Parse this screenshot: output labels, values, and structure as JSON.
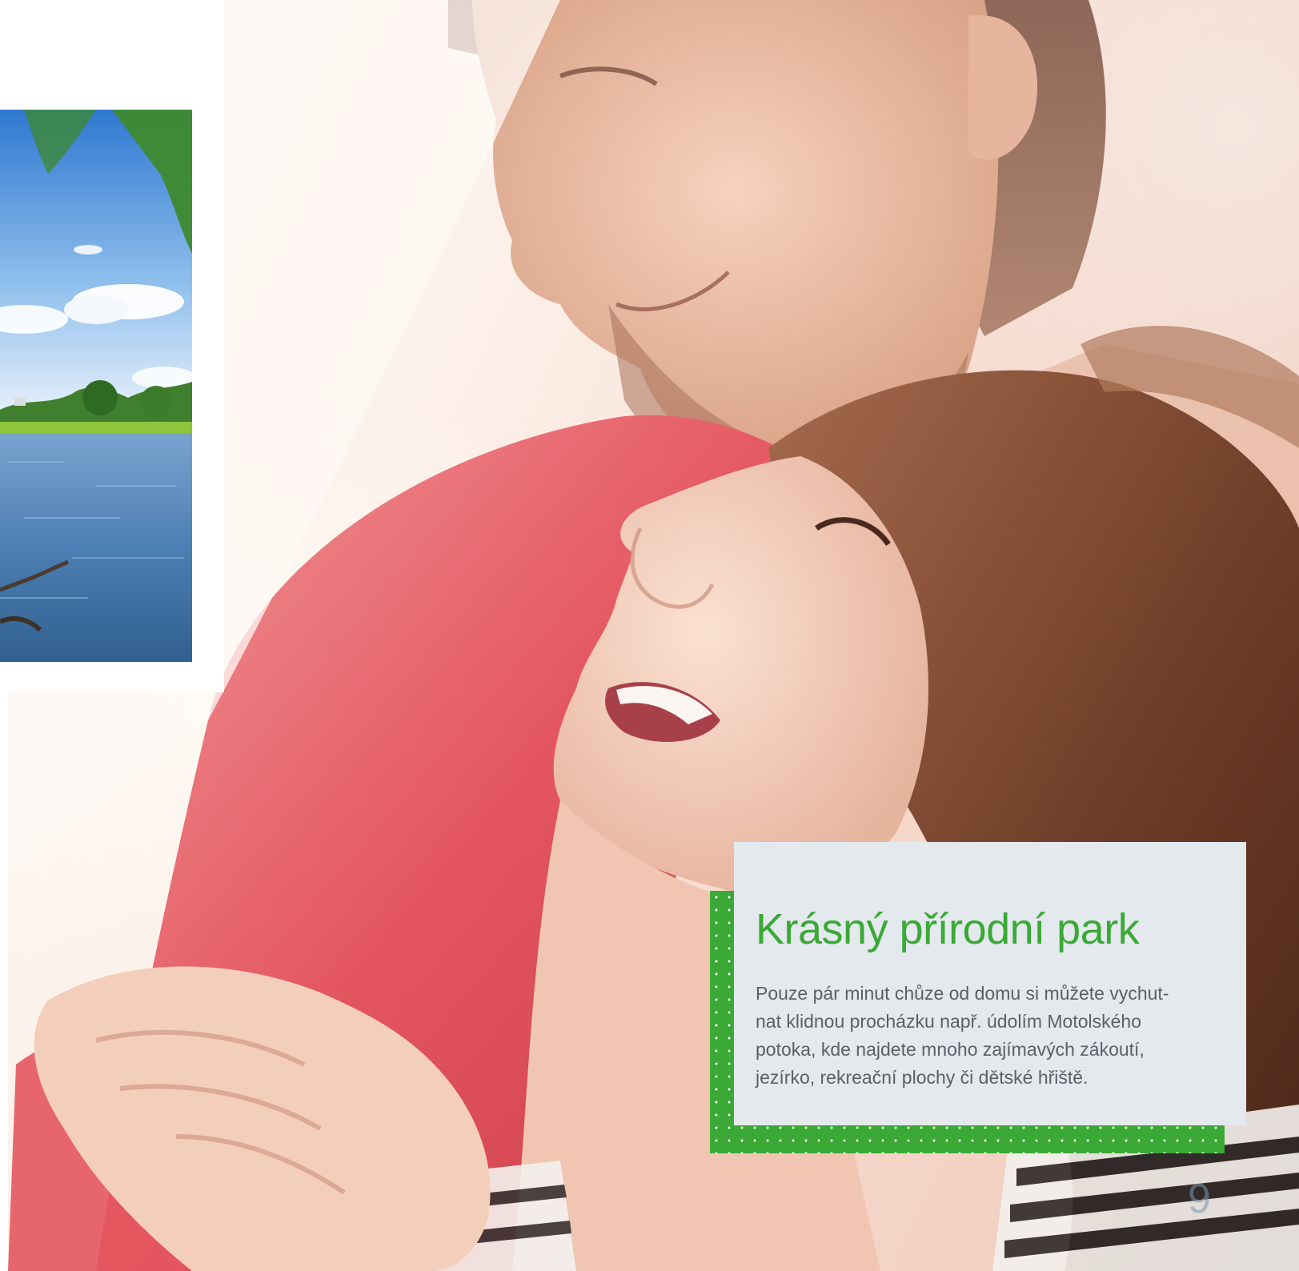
{
  "card": {
    "title": "Krásný přírodní park",
    "body": "Pouze pár minut chůze od domu si můžete vychut-\nnat klidnou procházku např. údolím Motolského\npotoka, kde najdete mnoho zajímavých zákoutí,\njezírko, rekreační plochy či dětské hřiště."
  },
  "page_number": "9",
  "colors": {
    "accent_green": "#3aa935",
    "card_background": "#e4e9ee",
    "body_text": "#5b6066"
  }
}
